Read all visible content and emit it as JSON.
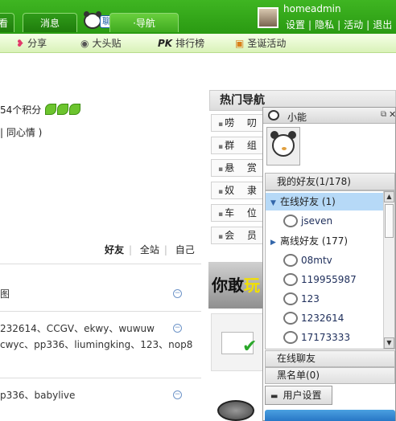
{
  "header": {
    "tab_partial": "看",
    "tab_news": "消息",
    "chat_badge": "聊",
    "tab_nav": "·导航",
    "username": "homeadmin",
    "links": [
      "设置",
      "隐私",
      "活动",
      "退出"
    ]
  },
  "subnav": {
    "share": "分享",
    "bigpost": "大头贴",
    "rank_icon": "PK",
    "rank": "排行榜",
    "xmas": "圣诞活动"
  },
  "left": {
    "points": "54个积分",
    "mood": "| 同心情 )",
    "filters": [
      "好友",
      "全站",
      "自己"
    ],
    "feeds": [
      {
        "lines": [
          "图"
        ]
      },
      {
        "lines": [
          "232614、CCGV、ekwy、wuwuw",
          "cwyc、pp336、liumingking、123、nop8"
        ]
      },
      {
        "lines": [
          "p336、babylive"
        ]
      }
    ]
  },
  "hot_nav": {
    "title": "热门导航",
    "items": [
      "唠 叨",
      "群 组",
      "悬 赏",
      "奴 隶",
      "车 位",
      "会 员"
    ],
    "banner_text": "你敢",
    "banner_highlight": "玩"
  },
  "chat": {
    "title": "小能",
    "my_friends": "我的好友(1/178)",
    "groups": [
      {
        "label": "在线好友 (1)",
        "arrow": "▼",
        "friends": [
          "jseven"
        ]
      },
      {
        "label": "离线好友 (177)",
        "arrow": "▶",
        "friends": [
          "08mtv",
          "119955987",
          "123",
          "1232614",
          "17173333"
        ]
      }
    ],
    "online_chat": "在线聊友",
    "blacklist": "黑名单(0)",
    "settings": "用户设置",
    "colors": {
      "header_green": "#2a9a12",
      "selection": "#b6d9f7"
    }
  }
}
